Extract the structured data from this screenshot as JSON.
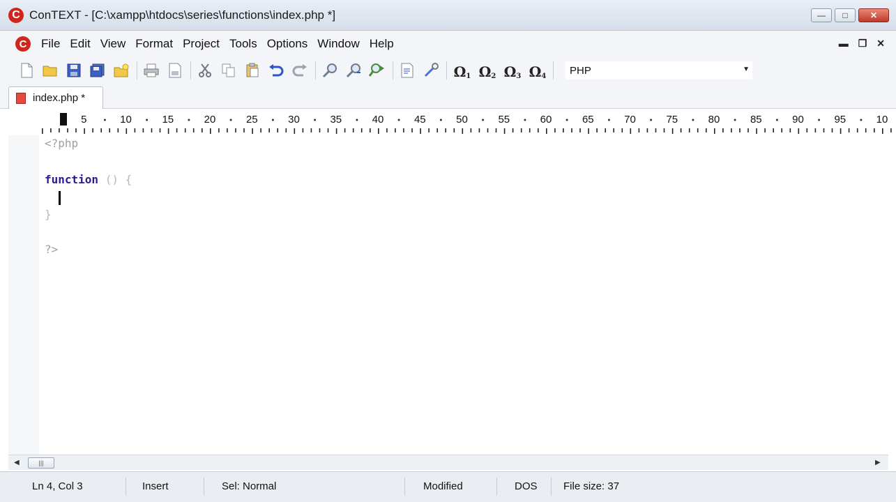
{
  "window": {
    "title": "ConTEXT - [C:\\xampp\\htdocs\\series\\functions\\index.php *]",
    "app_logo_letter": "C"
  },
  "menu": {
    "items": [
      "File",
      "Edit",
      "View",
      "Format",
      "Project",
      "Tools",
      "Options",
      "Window",
      "Help"
    ]
  },
  "toolbar": {
    "syntax_highlighter": "PHP",
    "macros": [
      {
        "glyph": "Ω",
        "sub": "1"
      },
      {
        "glyph": "Ω",
        "sub": "2"
      },
      {
        "glyph": "Ω",
        "sub": "3"
      },
      {
        "glyph": "Ω",
        "sub": "4"
      }
    ]
  },
  "tabs": [
    {
      "label": "index.php *",
      "active": true
    }
  ],
  "ruler": {
    "labels": [
      "5",
      "10",
      "15",
      "20",
      "25",
      "30",
      "35",
      "40",
      "45",
      "50",
      "55",
      "60",
      "65",
      "70",
      "75",
      "80",
      "85",
      "90",
      "95",
      "10"
    ]
  },
  "editor": {
    "lines": {
      "l1": "<?php",
      "l3_kw": "function",
      "l3_rest": " () {",
      "l4": "  ",
      "l5": "}",
      "l7": "?>"
    }
  },
  "status": {
    "position": "Ln 4, Col 3",
    "mode": "Insert",
    "selection": "Sel: Normal",
    "modified": "Modified",
    "line_endings": "DOS",
    "file_size": "File size: 37"
  }
}
